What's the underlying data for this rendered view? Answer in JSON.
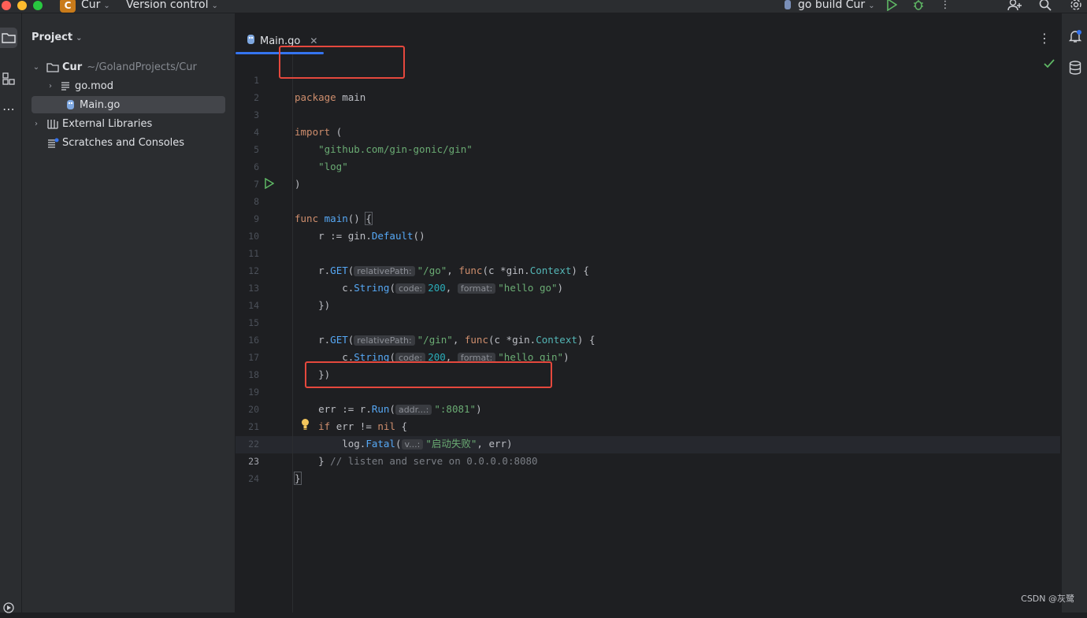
{
  "titlebar": {
    "project_badge": "C",
    "project_name": "Cur",
    "vcs_label": "Version control",
    "run_config": "go build Cur"
  },
  "project_panel": {
    "title": "Project",
    "tree": [
      {
        "label": "Cur",
        "hint": "~/GolandProjects/Cur"
      },
      {
        "label": "go.mod"
      },
      {
        "label": "Main.go"
      },
      {
        "label": "External Libraries"
      },
      {
        "label": "Scratches and Consoles"
      }
    ]
  },
  "editor": {
    "tab_label": "Main.go",
    "line_numbers": [
      "1",
      "2",
      "3",
      "4",
      "5",
      "6",
      "7",
      "8",
      "9",
      "10",
      "11",
      "12",
      "13",
      "14",
      "15",
      "16",
      "17",
      "18",
      "19",
      "20",
      "21",
      "22",
      "23",
      "24"
    ],
    "code": {
      "l1_kw": "package",
      "l1_name": "main",
      "l3_kw": "import",
      "l3_paren": " (",
      "l4_str": "\"github.com/gin-gonic/gin\"",
      "l5_str": "\"log\"",
      "l6": ")",
      "l8_kw": "func",
      "l8_fn": "main",
      "l8_rest": "() ",
      "l8_brace": "{",
      "l9_a": "r := ",
      "l9_pkg": "gin",
      "l9_dot": ".",
      "l9_fn": "Default",
      "l9_rest": "()",
      "l11_a": "r.",
      "l11_fn": "GET",
      "l11_p": "(",
      "l11_hint": "relativePath:",
      "l11_str": "\"/go\"",
      "l11_c": ", ",
      "l11_kw": "func",
      "l11_b": "(c *",
      "l11_pkg": "gin",
      "l11_dot": ".",
      "l11_type": "Context",
      "l11_rest": ") {",
      "l12_a": "c.",
      "l12_fn": "String",
      "l12_p": "(",
      "l12_hint1": "code:",
      "l12_num": "200",
      "l12_c": ", ",
      "l12_hint2": "format:",
      "l12_str": "\"hello go\"",
      "l12_rest": ")",
      "l13": "})",
      "l15_a": "r.",
      "l15_fn": "GET",
      "l15_p": "(",
      "l15_hint": "relativePath:",
      "l15_str": "\"/gin\"",
      "l15_c": ", ",
      "l15_kw": "func",
      "l15_b": "(c *",
      "l15_pkg": "gin",
      "l15_dot": ".",
      "l15_type": "Context",
      "l15_rest": ") {",
      "l16_a": "c.",
      "l16_fn": "String",
      "l16_p": "(",
      "l16_hint1": "code:",
      "l16_num": "200",
      "l16_c": ", ",
      "l16_hint2": "format:",
      "l16_str": "\"hello gin\"",
      "l16_rest": ")",
      "l17": "})",
      "l19_a": "err := r.",
      "l19_fn": "Run",
      "l19_p": "(",
      "l19_hint": "addr...:",
      "l19_str": "\":8081\"",
      "l19_rest": ")",
      "l20_kw": "if",
      "l20_a": " err != ",
      "l20_kw2": "nil",
      "l20_rest": " {",
      "l21_a": "log.",
      "l21_fn": "Fatal",
      "l21_p": "(",
      "l21_hint": "v...:",
      "l21_str": "\"启动失败\"",
      "l21_rest": ", err)",
      "l22_a": "} ",
      "l22_cmt": "// listen and serve on 0.0.0.0:8080",
      "l23": "}"
    }
  },
  "watermark": "CSDN @灰鹭",
  "colors": {
    "background": "#1e1f22",
    "panel": "#2b2d30",
    "accent": "#3574f0",
    "annotation_red": "#e5483d"
  }
}
